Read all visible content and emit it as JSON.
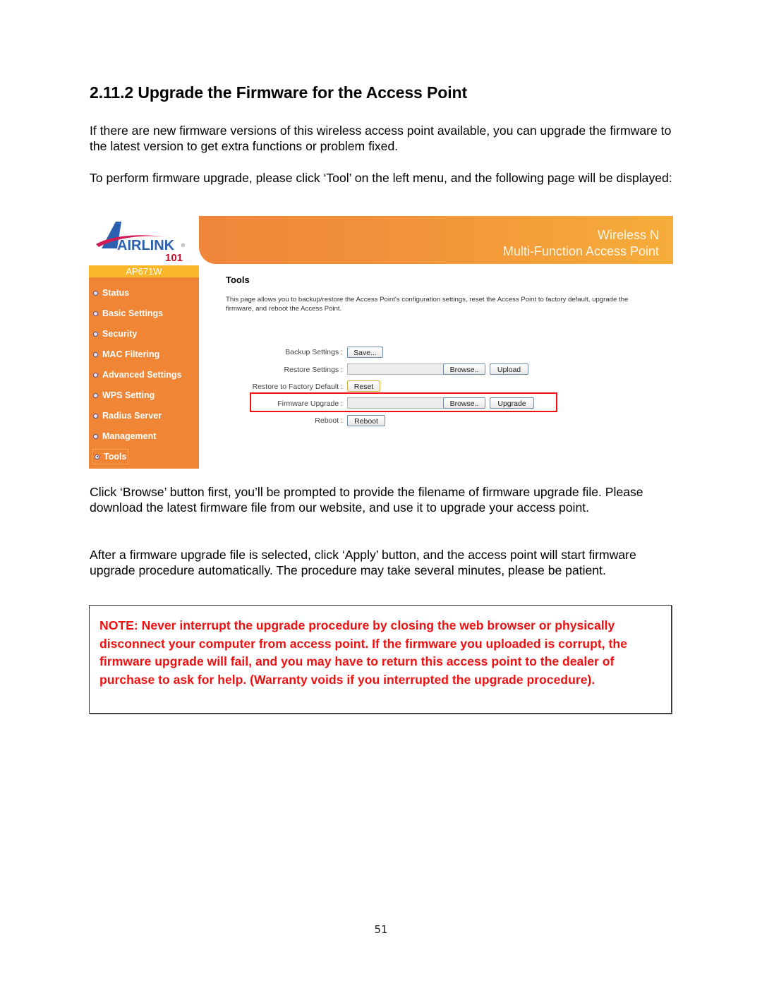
{
  "document": {
    "section_title": "2.11.2 Upgrade the Firmware for the Access Point",
    "paragraphs": [
      "If there are new firmware versions of this wireless access point available, you can upgrade the firmware to the latest version to get extra functions or problem fixed.",
      "To perform firmware upgrade, please click ‘Tool’ on the left menu, and the following page will be displayed:",
      "Click ‘Browse’ button first, you’ll be prompted to provide the filename of firmware upgrade file. Please download the latest firmware file from our website, and use it to upgrade your access point.",
      "After a firmware upgrade file is selected, click ‘Apply’ button, and the access point will start firmware upgrade procedure automatically. The procedure may take several minutes, please be patient."
    ],
    "note": "NOTE: Never interrupt the upgrade procedure by closing the web browser or physically disconnect your computer from access point. If the firmware you uploaded is corrupt, the firmware upgrade will fail, and you may have to return this access point to the dealer of purchase to ask for help. (Warranty voids if you interrupted the upgrade procedure).",
    "page_number": "51"
  },
  "screenshot": {
    "logo": {
      "brand": "AIRLINK",
      "sub": "101",
      "registered": "®"
    },
    "banner": {
      "line1": "Wireless N",
      "line2": "Multi-Function Access Point"
    },
    "model": "AP671W",
    "sidebar": {
      "items": [
        {
          "label": "Status"
        },
        {
          "label": "Basic Settings"
        },
        {
          "label": "Security"
        },
        {
          "label": "MAC Filtering"
        },
        {
          "label": "Advanced Settings"
        },
        {
          "label": "WPS Setting"
        },
        {
          "label": "Radius Server"
        },
        {
          "label": "Management"
        },
        {
          "label": "Tools",
          "active": true
        }
      ]
    },
    "content": {
      "title": "Tools",
      "description": "This page allows you to backup/restore the Access Point's configuration settings, reset the Access Point to factory default, upgrade the firmware, and reboot the Access Point.",
      "rows": {
        "backup": {
          "label": "Backup Settings :",
          "button": "Save..."
        },
        "restore": {
          "label": "Restore Settings :",
          "file_value": "",
          "browse": "Browse..",
          "button": "Upload"
        },
        "factory": {
          "label": "Restore to Factory Default :",
          "button": "Reset"
        },
        "firmware": {
          "label": "Firmware Upgrade :",
          "file_value": "",
          "browse": "Browse..",
          "button": "Upgrade"
        },
        "reboot": {
          "label": "Reboot :",
          "button": "Reboot"
        }
      }
    },
    "colors": {
      "sidebar_orange": "#f08535",
      "model_bar": "#f9b72a",
      "highlight_red": "#ee1111"
    }
  }
}
